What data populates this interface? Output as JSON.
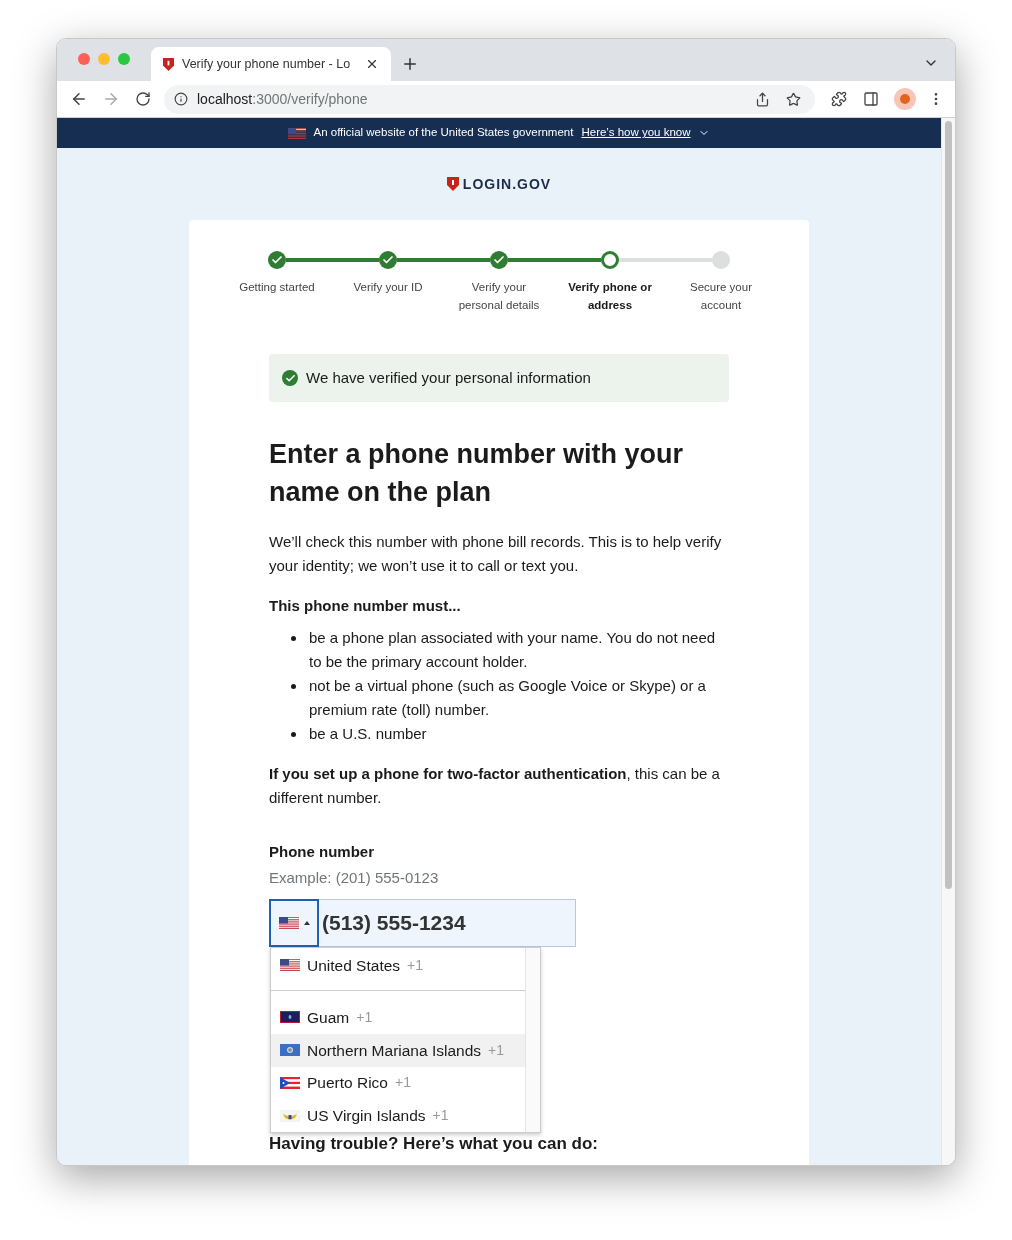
{
  "browser": {
    "tab_title": "Verify your phone number - Lo",
    "url_host": "localhost",
    "url_path": ":3000/verify/phone"
  },
  "gov_banner": {
    "text": "An official website of the United States government",
    "link": "Here’s how you know"
  },
  "logo": "LOGIN.GOV",
  "steps": [
    {
      "label": "Getting started",
      "kind": "complete"
    },
    {
      "label": "Verify your ID",
      "kind": "complete"
    },
    {
      "label": "Verify your personal details",
      "kind": "complete"
    },
    {
      "label": "Verify phone or address",
      "kind": "current"
    },
    {
      "label": "Secure your account",
      "kind": "pending"
    }
  ],
  "alert": {
    "text": "We have verified your personal information"
  },
  "heading": "Enter a phone number with your name on the plan",
  "intro": "We’ll check this number with phone bill records. This is to help verify your identity; we won’t use it to call or text you.",
  "must_title": "This phone number must...",
  "must_items": [
    "be a phone plan associated with your name. You do not need to be the primary account holder.",
    "not be a virtual phone (such as Google Voice or Skype) or a premium rate (toll) number.",
    "be a U.S. number"
  ],
  "note": "**If you set up a phone for two-factor authentication**, this can be a different number.",
  "phone": {
    "label": "Phone number",
    "hint": "Example: (201) 555-0123",
    "value": "(513) 555-1234",
    "flag": {
      "kind": "us"
    },
    "dropdown_open": true
  },
  "countries": [
    {
      "name": "United States",
      "code": "+1",
      "kind": "us",
      "preferred": true,
      "selected": false
    },
    {
      "name": "Guam",
      "code": "+1",
      "kind": "gu",
      "preferred": false,
      "selected": false
    },
    {
      "name": "Northern Mariana Islands",
      "code": "+1",
      "kind": "mp",
      "preferred": false,
      "selected": true
    },
    {
      "name": "Puerto Rico",
      "code": "+1",
      "kind": "pr",
      "preferred": false,
      "selected": false
    },
    {
      "name": "US Virgin Islands",
      "code": "+1",
      "kind": "vi",
      "preferred": false,
      "selected": false
    }
  ],
  "trouble_heading": "Having trouble? Here’s what you can do:"
}
